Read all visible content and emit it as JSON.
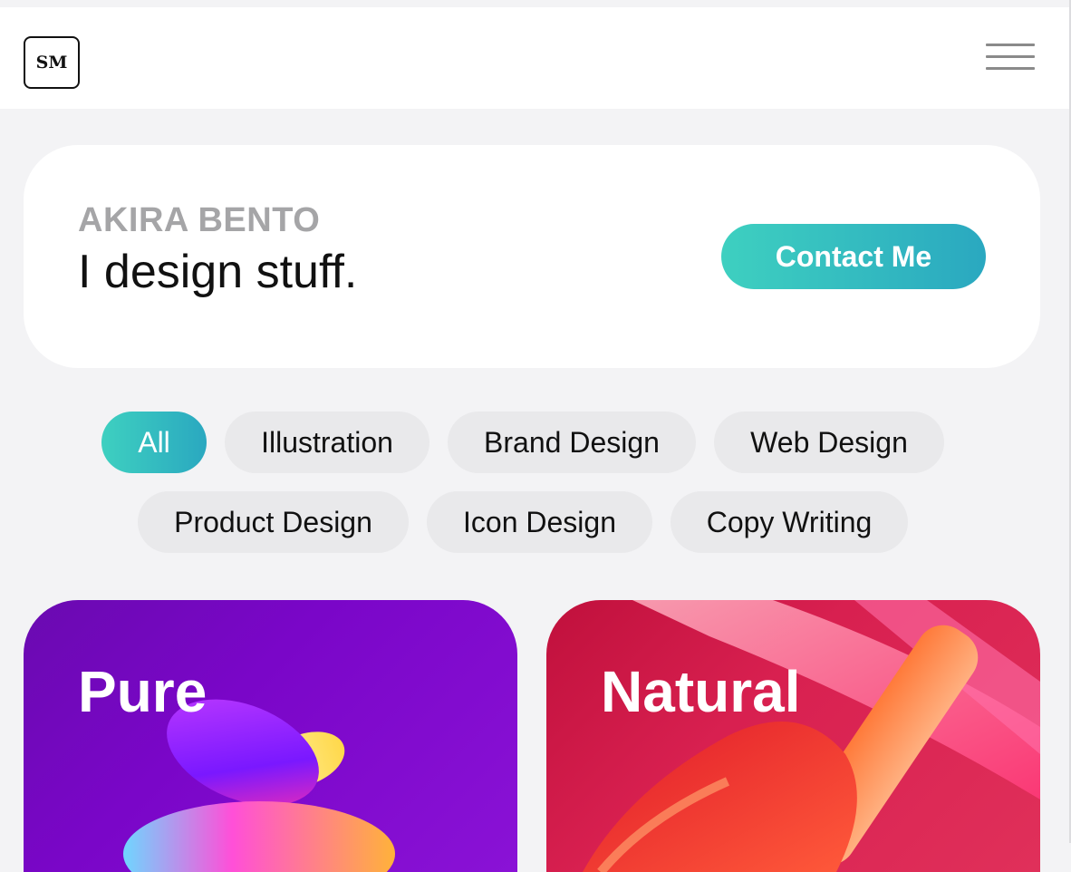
{
  "header": {
    "logo_text": "SM",
    "menu_icon": "hamburger-menu-icon"
  },
  "intro": {
    "name": "AKIRA BENTO",
    "tagline": "I design stuff.",
    "contact_label": "Contact Me"
  },
  "filters": {
    "rows": [
      [
        {
          "label": "All",
          "active": true
        },
        {
          "label": "Illustration",
          "active": false
        },
        {
          "label": "Brand Design",
          "active": false
        },
        {
          "label": "Web Design",
          "active": false
        }
      ],
      [
        {
          "label": "Product Design",
          "active": false
        },
        {
          "label": "Icon Design",
          "active": false
        },
        {
          "label": "Copy Writing",
          "active": false
        }
      ]
    ]
  },
  "projects": [
    {
      "title": "Pure",
      "color": "#7a06c8"
    },
    {
      "title": "Natural",
      "color": "#d82050"
    }
  ],
  "colors": {
    "accent_start": "#3ed0c0",
    "accent_end": "#2aa8c0",
    "background": "#f3f3f5"
  }
}
